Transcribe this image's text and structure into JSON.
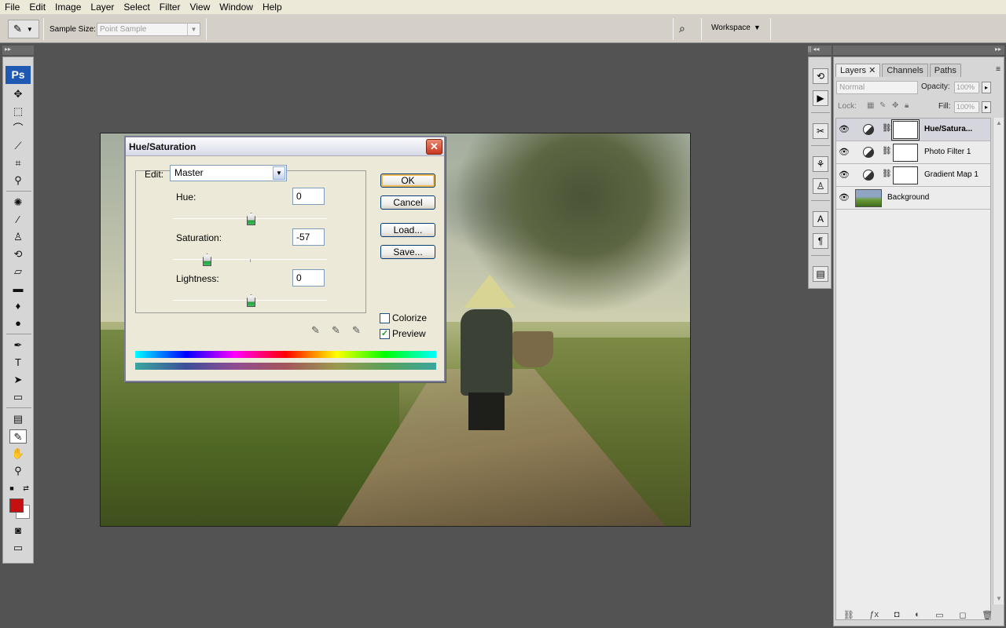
{
  "menu": [
    "File",
    "Edit",
    "Image",
    "Layer",
    "Select",
    "Filter",
    "View",
    "Window",
    "Help"
  ],
  "options_bar": {
    "sample_size_label": "Sample Size:",
    "sample_size_value": "Point Sample",
    "workspace_label": "Workspace"
  },
  "toolbox": {
    "logo": "Ps",
    "foreground_color": "#c41010",
    "background_color": "#ffffff"
  },
  "dialog": {
    "title": "Hue/Saturation",
    "close_label": "✕",
    "edit_label": "Edit:",
    "edit_value": "Master",
    "hue_label": "Hue:",
    "hue_value": "0",
    "saturation_label": "Saturation:",
    "saturation_value": "-57",
    "lightness_label": "Lightness:",
    "lightness_value": "0",
    "buttons": {
      "ok": "OK",
      "cancel": "Cancel",
      "load": "Load...",
      "save": "Save..."
    },
    "colorize_label": "Colorize",
    "colorize_checked": false,
    "preview_label": "Preview",
    "preview_checked": true
  },
  "layers_panel": {
    "tabs": [
      "Layers",
      "Channels",
      "Paths"
    ],
    "blend_mode": "Normal",
    "opacity_label": "Opacity:",
    "opacity_value": "100%",
    "lock_label": "Lock:",
    "fill_label": "Fill:",
    "fill_value": "100%",
    "layers": [
      {
        "name": "Hue/Satura...",
        "type": "adjustment",
        "selected": true
      },
      {
        "name": "Photo Filter 1",
        "type": "adjustment",
        "selected": false
      },
      {
        "name": "Gradient Map 1",
        "type": "adjustment",
        "selected": false
      },
      {
        "name": "Background",
        "type": "image",
        "selected": false
      }
    ]
  }
}
